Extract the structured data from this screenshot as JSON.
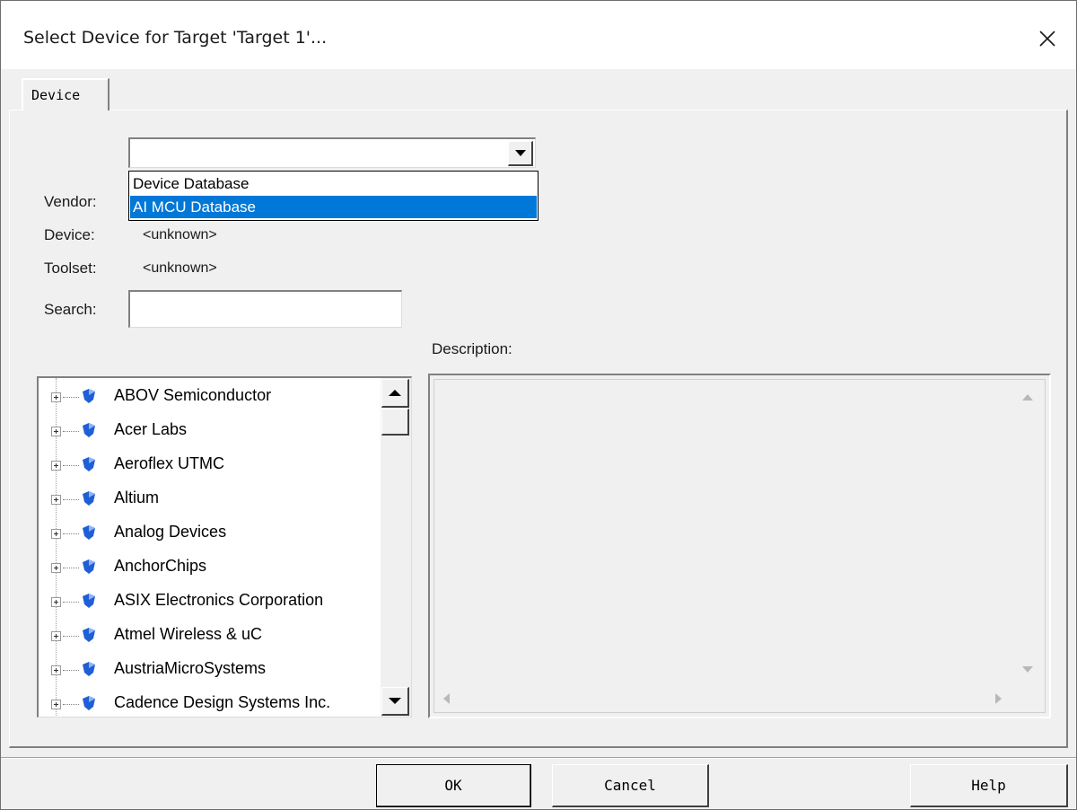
{
  "window": {
    "title": "Select Device for Target 'Target 1'..."
  },
  "tab": {
    "label": "Device"
  },
  "database_select": {
    "value": "",
    "options": [
      "Device Database",
      "AI MCU Database"
    ],
    "highlighted": "AI MCU Database"
  },
  "fields": {
    "vendor_label": "Vendor:",
    "vendor_value": "",
    "device_label": "Device:",
    "device_value": "<unknown>",
    "toolset_label": "Toolset:",
    "toolset_value": "<unknown>",
    "search_label": "Search:",
    "search_value": ""
  },
  "description": {
    "label": "Description:"
  },
  "vendors": [
    "ABOV Semiconductor",
    "Acer Labs",
    "Aeroflex UTMC",
    "Altium",
    "Analog Devices",
    "AnchorChips",
    "ASIX Electronics Corporation",
    "Atmel Wireless & uC",
    "AustriaMicroSystems",
    "Cadence Design Systems Inc."
  ],
  "buttons": {
    "ok": "OK",
    "cancel": "Cancel",
    "help": "Help"
  },
  "colors": {
    "selection": "#0078d7",
    "chip_icon": "#1f5fd6"
  }
}
